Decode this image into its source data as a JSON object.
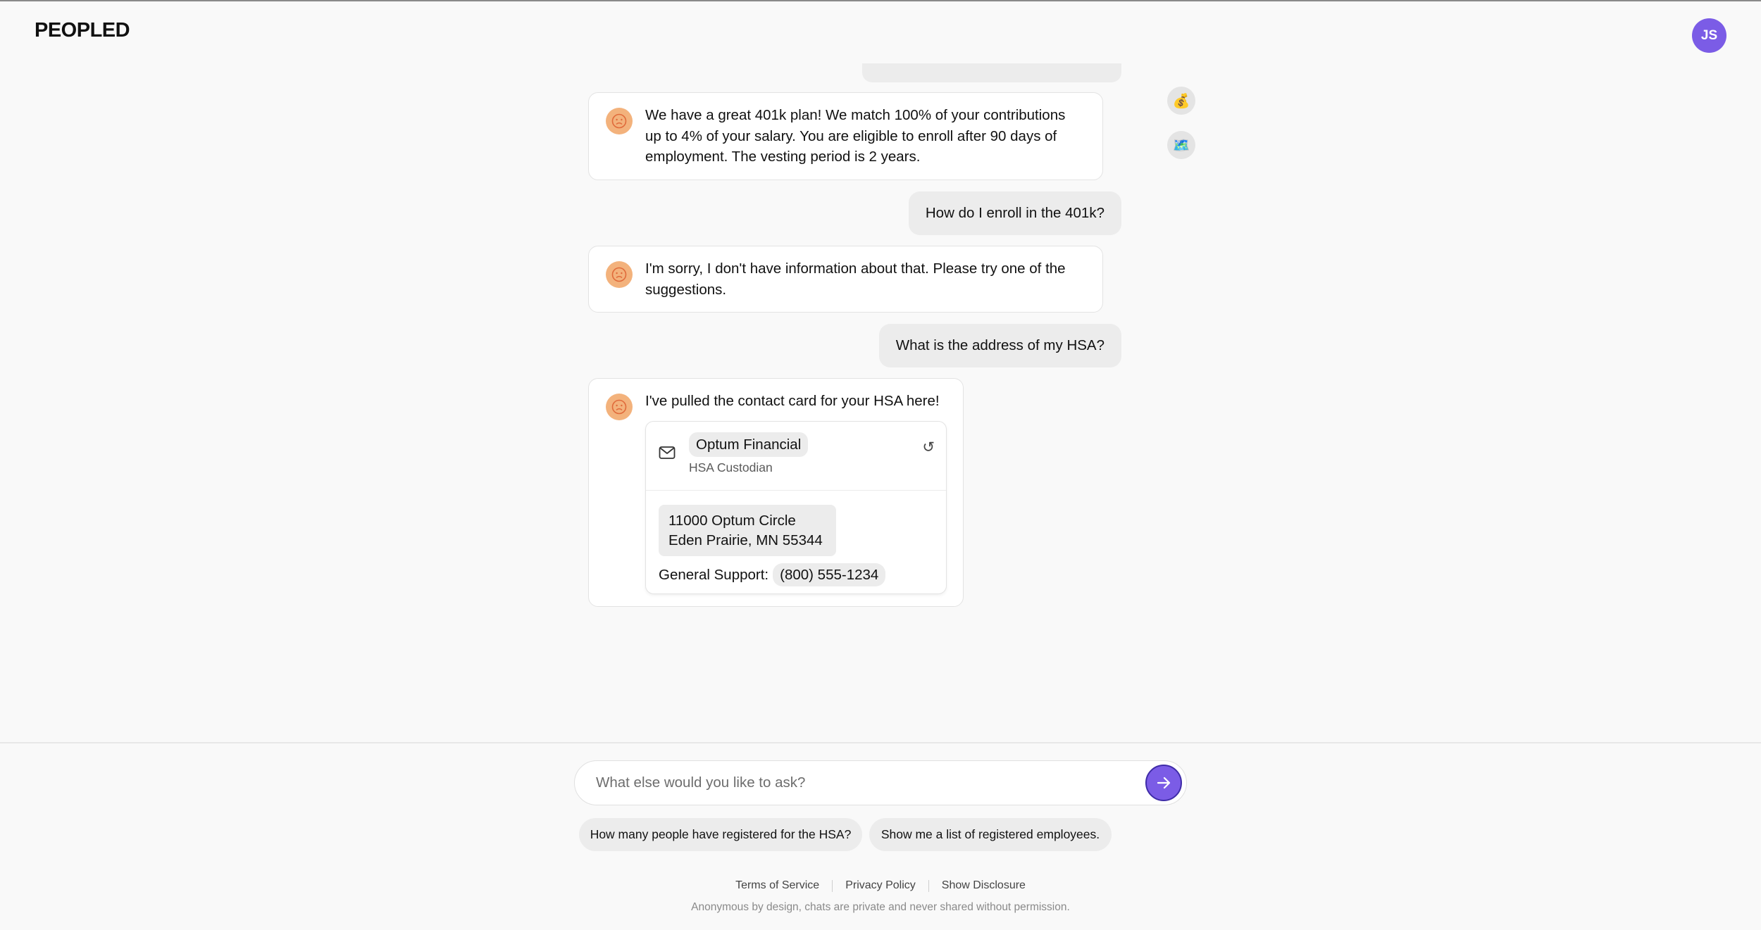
{
  "header": {
    "logo": "PEOPLED",
    "user_initials": "JS"
  },
  "side_icons": [
    {
      "name": "money-bag-icon",
      "glyph": "💰"
    },
    {
      "name": "map-icon",
      "glyph": "🗺️"
    }
  ],
  "messages": [
    {
      "role": "bot",
      "text": "We have a great 401k plan! We match 100% of your contributions up to 4% of your salary. You are eligible to enroll after 90 days of employment. The vesting period is 2 years."
    },
    {
      "role": "user",
      "text": "How do I enroll in the 401k?"
    },
    {
      "role": "bot",
      "text": "I'm sorry, I don't have information about that. Please try one of the suggestions."
    },
    {
      "role": "user",
      "text": "What is the address of my HSA?"
    },
    {
      "role": "bot",
      "text": "I've pulled the contact card for your HSA here!"
    }
  ],
  "contact_card": {
    "name": "Optum Financial",
    "role": "HSA Custodian",
    "address_line1": "11000 Optum Circle",
    "address_line2": "Eden Prairie, MN 55344",
    "support_label": "General Support:",
    "phone": "(800) 555-1234"
  },
  "composer": {
    "placeholder": "What else would you like to ask?"
  },
  "suggestions": [
    "How many people have registered for the HSA?",
    "Show me a list of registered employees."
  ],
  "footer": {
    "links": [
      "Terms of Service",
      "Privacy Policy",
      "Show Disclosure"
    ],
    "note": "Anonymous by design, chats are private and never shared without permission."
  },
  "colors": {
    "accent": "#7b5ce6",
    "bot_avatar": "#f3b27c",
    "bubble_gray": "#ececec"
  }
}
